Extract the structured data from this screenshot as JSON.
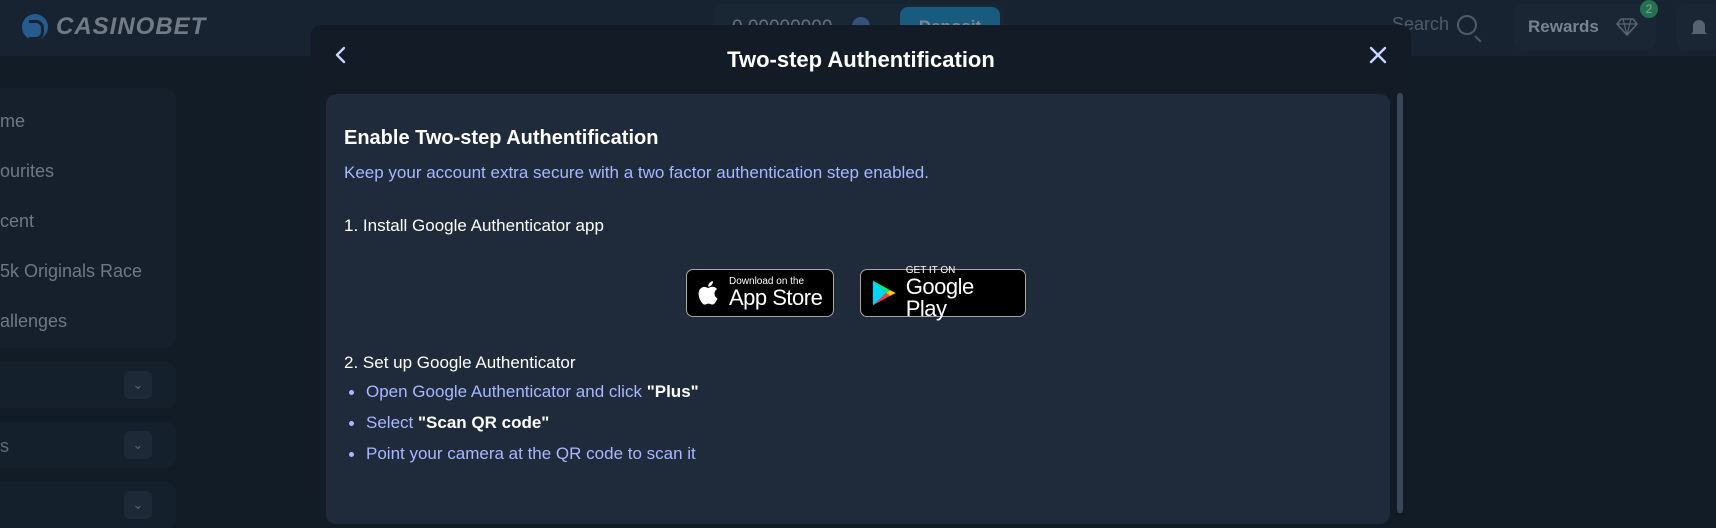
{
  "header": {
    "logo_text": "CASINOBET",
    "balance": "0.00000000",
    "deposit_label": "Deposit",
    "search_label": "Search",
    "rewards_label": "Rewards",
    "rewards_badge": "2"
  },
  "sidebar": {
    "items": [
      {
        "label": "me"
      },
      {
        "label": "ourites"
      },
      {
        "label": "cent"
      },
      {
        "label": "5k Originals Race"
      },
      {
        "label": "allenges"
      }
    ],
    "collapsibles": [
      {
        "label": ""
      },
      {
        "label": "s"
      },
      {
        "label": ""
      }
    ]
  },
  "modal": {
    "title": "Two-step Authentification",
    "heading": "Enable Two-step Authentification",
    "subtitle": "Keep your account extra secure with a two factor authentication step enabled.",
    "step1": "1. Install Google Authenticator app",
    "app_store": {
      "small": "Download on the",
      "large": "App Store"
    },
    "google_play": {
      "small": "GET IT ON",
      "large": "Google Play"
    },
    "step2": "2. Set up Google Authenticator",
    "instructions": [
      {
        "text": "Open Google Authenticator and click ",
        "bold": "\"Plus\""
      },
      {
        "text": "Select ",
        "bold": "\"Scan QR code\""
      },
      {
        "text": "Point your camera at the QR code to scan it",
        "bold": ""
      }
    ]
  },
  "colors": {
    "accent_text": "#aab6ff",
    "deposit": "#1c9de0",
    "badge_green": "#2bb36b"
  }
}
